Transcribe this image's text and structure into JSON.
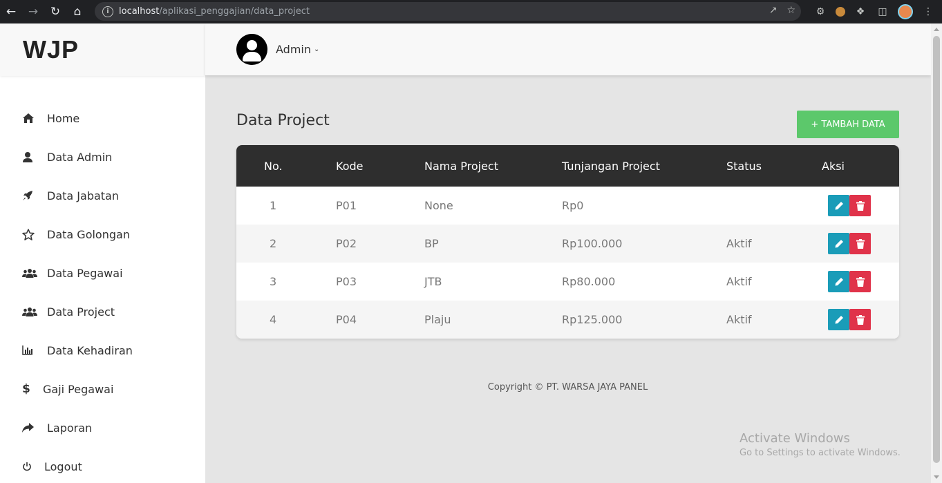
{
  "browser": {
    "url_host": "localhost",
    "url_path": "/aplikasi_penggajian/data_project"
  },
  "sidebar": {
    "brand": "WJP",
    "items": [
      {
        "label": "Home",
        "icon": "home-icon"
      },
      {
        "label": "Data Admin",
        "icon": "user-icon"
      },
      {
        "label": "Data Jabatan",
        "icon": "rocket-icon"
      },
      {
        "label": "Data Golongan",
        "icon": "star-icon"
      },
      {
        "label": "Data Pegawai",
        "icon": "users-icon"
      },
      {
        "label": "Data Project",
        "icon": "users-icon"
      },
      {
        "label": "Data Kehadiran",
        "icon": "bar-chart-icon"
      },
      {
        "label": "Gaji Pegawai",
        "icon": "dollar-icon"
      },
      {
        "label": "Laporan",
        "icon": "share-icon"
      },
      {
        "label": "Logout",
        "icon": "power-icon"
      }
    ]
  },
  "header": {
    "user_name": "Admin"
  },
  "main": {
    "title": "Data Project",
    "add_button": "+ TAMBAH DATA",
    "table": {
      "headers": [
        "No.",
        "Kode",
        "Nama Project",
        "Tunjangan Project",
        "Status",
        "Aksi"
      ],
      "rows": [
        {
          "no": "1",
          "kode": "P01",
          "nama": "None",
          "tunjangan": "Rp0",
          "status": ""
        },
        {
          "no": "2",
          "kode": "P02",
          "nama": "BP",
          "tunjangan": "Rp100.000",
          "status": "Aktif"
        },
        {
          "no": "3",
          "kode": "P03",
          "nama": "JTB",
          "tunjangan": "Rp80.000",
          "status": "Aktif"
        },
        {
          "no": "4",
          "kode": "P04",
          "nama": "Plaju",
          "tunjangan": "Rp125.000",
          "status": "Aktif"
        }
      ]
    }
  },
  "footer": {
    "copyright": "Copyright © PT. WARSA JAYA PANEL"
  },
  "watermark": {
    "line1": "Activate Windows",
    "line2": "Go to Settings to activate Windows."
  },
  "colors": {
    "add_button": "#5cc86b",
    "edit_button": "#1a9cb8",
    "delete_button": "#e0334a",
    "table_header": "#2e2e2e"
  }
}
